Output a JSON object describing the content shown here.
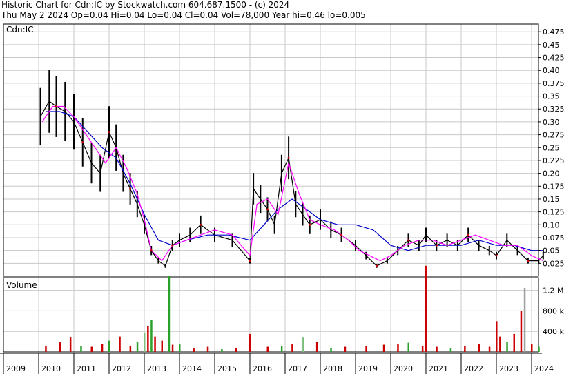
{
  "header": {
    "line1": "Historic Chart for Cdn:IC by Stockwatch.com 604.687.1500 - (c) 2024",
    "line2": "Thu May  2 2024  Op=0.04  Hi=0.04  Lo=0.04  Cl=0.04  Vol=78,000  Year hi=0.46  lo=0.005"
  },
  "chart_data": [
    {
      "type": "line",
      "panel": "price",
      "title": "Cdn:IC",
      "ylim": [
        0,
        0.49
      ],
      "y_ticks": [
        "0.475",
        "0.45",
        "0.425",
        "0.40",
        "0.375",
        "0.35",
        "0.325",
        "0.30",
        "0.275",
        "0.25",
        "0.225",
        "0.20",
        "0.175",
        "0.15",
        "0.125",
        "0.10",
        "0.075",
        "0.05",
        "0.025"
      ],
      "x_ticks": [
        "2009",
        "2010",
        "2011",
        "2012",
        "2013",
        "2014",
        "2015",
        "2016",
        "2017",
        "2018",
        "2019",
        "2020",
        "2021",
        "2022",
        "2023",
        "2024"
      ],
      "grid": true,
      "colors": {
        "price_bars": "#000000",
        "ma_short": "#ff00ff",
        "ma_long": "#0000cc",
        "highlight": "#cc0000"
      },
      "series": [
        {
          "role": "close",
          "x": [
            2010.05,
            2010.3,
            2010.5,
            2010.75,
            2011.0,
            2011.25,
            2011.5,
            2011.75,
            2012.0,
            2012.2,
            2012.4,
            2012.6,
            2012.8,
            2013.0,
            2013.2,
            2013.4,
            2013.6,
            2013.8,
            2014.0,
            2014.3,
            2014.6,
            2015.0,
            2015.5,
            2016.0,
            2016.1,
            2016.3,
            2016.5,
            2016.7,
            2016.9,
            2017.1,
            2017.3,
            2017.5,
            2017.7,
            2018.0,
            2018.3,
            2018.6,
            2019.0,
            2019.3,
            2019.6,
            2019.9,
            2020.2,
            2020.5,
            2020.8,
            2021.0,
            2021.3,
            2021.6,
            2021.9,
            2022.2,
            2022.5,
            2022.8,
            2023.0,
            2023.3,
            2023.6,
            2023.9,
            2024.2,
            2024.33
          ],
          "y": [
            0.31,
            0.34,
            0.33,
            0.32,
            0.3,
            0.26,
            0.22,
            0.2,
            0.28,
            0.25,
            0.2,
            0.17,
            0.14,
            0.1,
            0.05,
            0.03,
            0.02,
            0.06,
            0.07,
            0.08,
            0.1,
            0.08,
            0.07,
            0.03,
            0.17,
            0.15,
            0.13,
            0.1,
            0.2,
            0.23,
            0.14,
            0.12,
            0.1,
            0.11,
            0.09,
            0.08,
            0.06,
            0.04,
            0.02,
            0.03,
            0.05,
            0.07,
            0.06,
            0.08,
            0.06,
            0.07,
            0.06,
            0.08,
            0.06,
            0.05,
            0.04,
            0.07,
            0.05,
            0.03,
            0.03,
            0.04
          ]
        },
        {
          "role": "ma_short",
          "x": [
            2010.1,
            2010.4,
            2010.7,
            2011.0,
            2011.3,
            2011.6,
            2011.9,
            2012.2,
            2012.5,
            2012.8,
            2013.0,
            2013.2,
            2013.5,
            2013.8,
            2014.2,
            2014.6,
            2015.0,
            2015.5,
            2016.0,
            2016.2,
            2016.5,
            2016.8,
            2017.1,
            2017.4,
            2017.7,
            2018.0,
            2018.4,
            2018.8,
            2019.1,
            2019.4,
            2019.7,
            2020.0,
            2020.4,
            2020.8,
            2021.2,
            2021.6,
            2022.0,
            2022.4,
            2022.8,
            2023.2,
            2023.6,
            2024.0,
            2024.33
          ],
          "y": [
            0.3,
            0.33,
            0.33,
            0.31,
            0.28,
            0.25,
            0.22,
            0.25,
            0.21,
            0.16,
            0.11,
            0.05,
            0.03,
            0.06,
            0.07,
            0.08,
            0.09,
            0.08,
            0.04,
            0.14,
            0.15,
            0.12,
            0.22,
            0.16,
            0.11,
            0.1,
            0.09,
            0.07,
            0.05,
            0.04,
            0.03,
            0.04,
            0.06,
            0.07,
            0.07,
            0.06,
            0.07,
            0.08,
            0.07,
            0.06,
            0.06,
            0.04,
            0.03
          ]
        },
        {
          "role": "ma_long",
          "x": [
            2010.2,
            2010.6,
            2011.0,
            2011.4,
            2011.8,
            2012.2,
            2012.6,
            2013.0,
            2013.4,
            2013.8,
            2014.2,
            2014.8,
            2015.4,
            2016.0,
            2016.4,
            2016.8,
            2017.2,
            2017.6,
            2018.0,
            2018.5,
            2019.0,
            2019.5,
            2020.0,
            2020.5,
            2021.0,
            2021.5,
            2022.0,
            2022.5,
            2023.0,
            2023.5,
            2024.0,
            2024.33
          ],
          "y": [
            0.32,
            0.32,
            0.31,
            0.28,
            0.25,
            0.23,
            0.18,
            0.12,
            0.07,
            0.06,
            0.07,
            0.08,
            0.08,
            0.07,
            0.1,
            0.13,
            0.15,
            0.13,
            0.11,
            0.1,
            0.1,
            0.09,
            0.06,
            0.05,
            0.06,
            0.06,
            0.06,
            0.07,
            0.06,
            0.06,
            0.05,
            0.05
          ]
        }
      ]
    },
    {
      "type": "bar",
      "panel": "volume",
      "title": "Volume",
      "ylim": [
        0,
        1.45
      ],
      "y_ticks": [
        "1.2 M",
        "800 k",
        "400 k"
      ],
      "x": [
        2010.2,
        2010.6,
        2010.9,
        2011.2,
        2011.5,
        2011.8,
        2012.0,
        2012.3,
        2012.6,
        2012.8,
        2013.0,
        2013.1,
        2013.2,
        2013.3,
        2013.5,
        2013.7,
        2013.8,
        2014.0,
        2014.4,
        2014.8,
        2015.2,
        2015.6,
        2016.0,
        2016.5,
        2016.9,
        2017.2,
        2017.5,
        2017.9,
        2018.3,
        2018.7,
        2019.3,
        2019.8,
        2020.2,
        2020.5,
        2020.9,
        2021.0,
        2021.3,
        2021.7,
        2022.1,
        2022.5,
        2022.8,
        2023.0,
        2023.1,
        2023.3,
        2023.5,
        2023.7,
        2023.8,
        2024.0,
        2024.2
      ],
      "values": [
        0.12,
        0.2,
        0.28,
        0.12,
        0.1,
        0.15,
        0.22,
        0.3,
        0.12,
        0.2,
        0.38,
        0.5,
        0.62,
        0.3,
        0.22,
        1.48,
        0.14,
        0.16,
        0.08,
        0.1,
        0.06,
        0.08,
        0.35,
        0.1,
        0.12,
        0.15,
        0.28,
        0.2,
        0.08,
        0.1,
        0.12,
        0.14,
        0.15,
        0.18,
        0.12,
        1.68,
        0.1,
        0.08,
        0.12,
        0.15,
        0.1,
        0.6,
        0.3,
        0.2,
        0.35,
        0.8,
        1.25,
        0.15,
        0.1
      ],
      "colors": [
        "#cc0000",
        "#cc0000",
        "#cc0000",
        "#2ca02c",
        "#cc0000",
        "#cc0000",
        "#2ca02c",
        "#cc0000",
        "#cc0000",
        "#2ca02c",
        "#7fbf7f",
        "#cc0000",
        "#2ca02c",
        "#cc0000",
        "#cc0000",
        "#2ca02c",
        "#cc0000",
        "#2ca02c",
        "#cc0000",
        "#cc0000",
        "#2ca02c",
        "#cc0000",
        "#cc0000",
        "#cc0000",
        "#2ca02c",
        "#cc0000",
        "#7fbf7f",
        "#cc0000",
        "#2ca02c",
        "#cc0000",
        "#cc0000",
        "#cc0000",
        "#cc0000",
        "#2ca02c",
        "#cc0000",
        "#cc0000",
        "#cc0000",
        "#2ca02c",
        "#cc0000",
        "#cc0000",
        "#cc0000",
        "#cc0000",
        "#cc0000",
        "#2ca02c",
        "#cc0000",
        "#cc0000",
        "#a0a0a0",
        "#cc0000",
        "#2ca02c"
      ]
    }
  ]
}
